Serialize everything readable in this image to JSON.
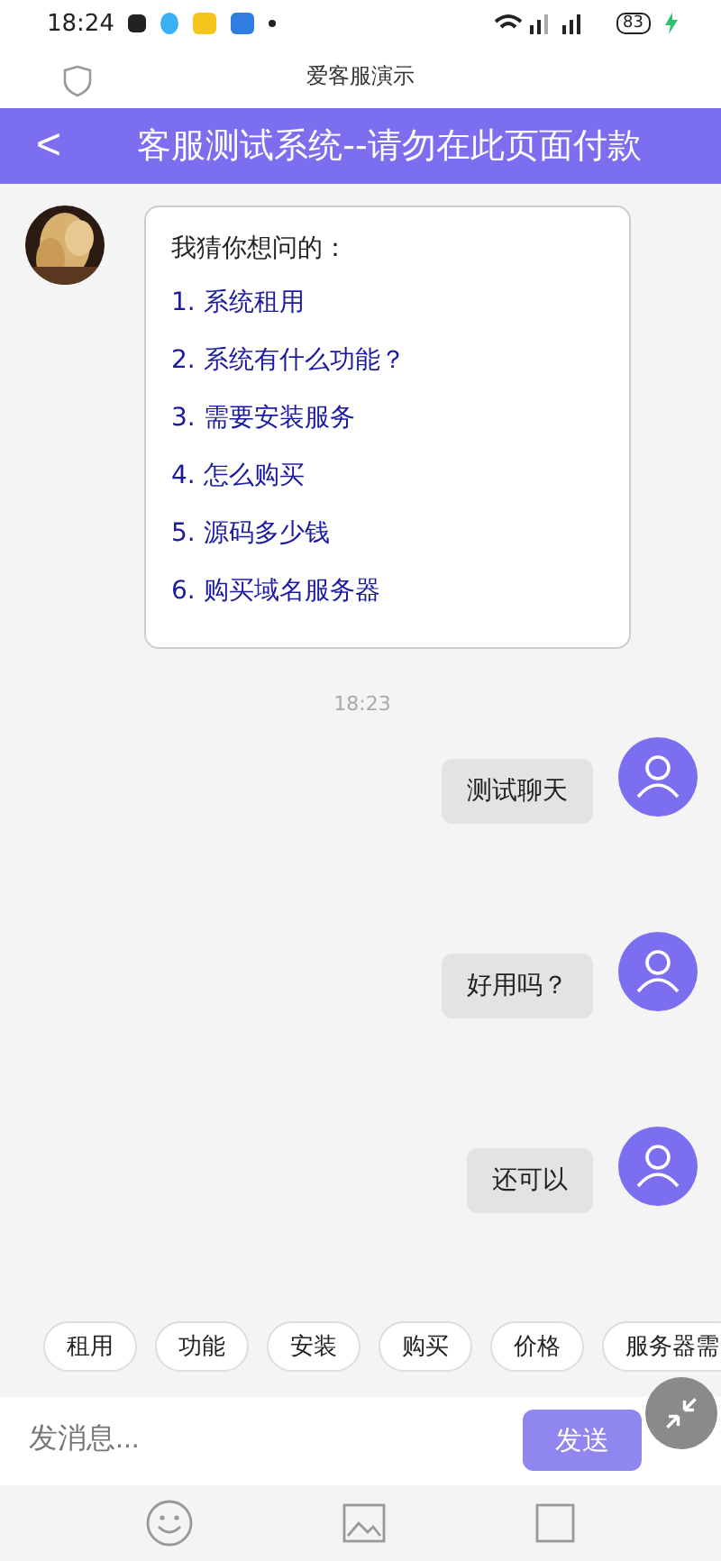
{
  "status_bar": {
    "time": "18:24",
    "battery": "83"
  },
  "browser_bar": {
    "title": "爱客服演示"
  },
  "header": {
    "back": "<",
    "title": "客服测试系统--请勿在此页面付款"
  },
  "bot_message": {
    "heading": "我猜你想问的：",
    "items": [
      {
        "number": "1.",
        "text": "系统租用"
      },
      {
        "number": "2.",
        "text": "系统有什么功能？"
      },
      {
        "number": "3.",
        "text": "需要安装服务"
      },
      {
        "number": "4.",
        "text": "怎么购买"
      },
      {
        "number": "5.",
        "text": "源码多少钱"
      },
      {
        "number": "6.",
        "text": "购买域名服务器"
      }
    ]
  },
  "timestamp": "18:23",
  "user_messages": [
    "测试聊天",
    "好用吗？",
    "还可以"
  ],
  "quick_replies": [
    "租用",
    "功能",
    "安装",
    "购买",
    "价格",
    "服务器需"
  ],
  "input": {
    "placeholder": "发消息...",
    "send": "发送"
  }
}
